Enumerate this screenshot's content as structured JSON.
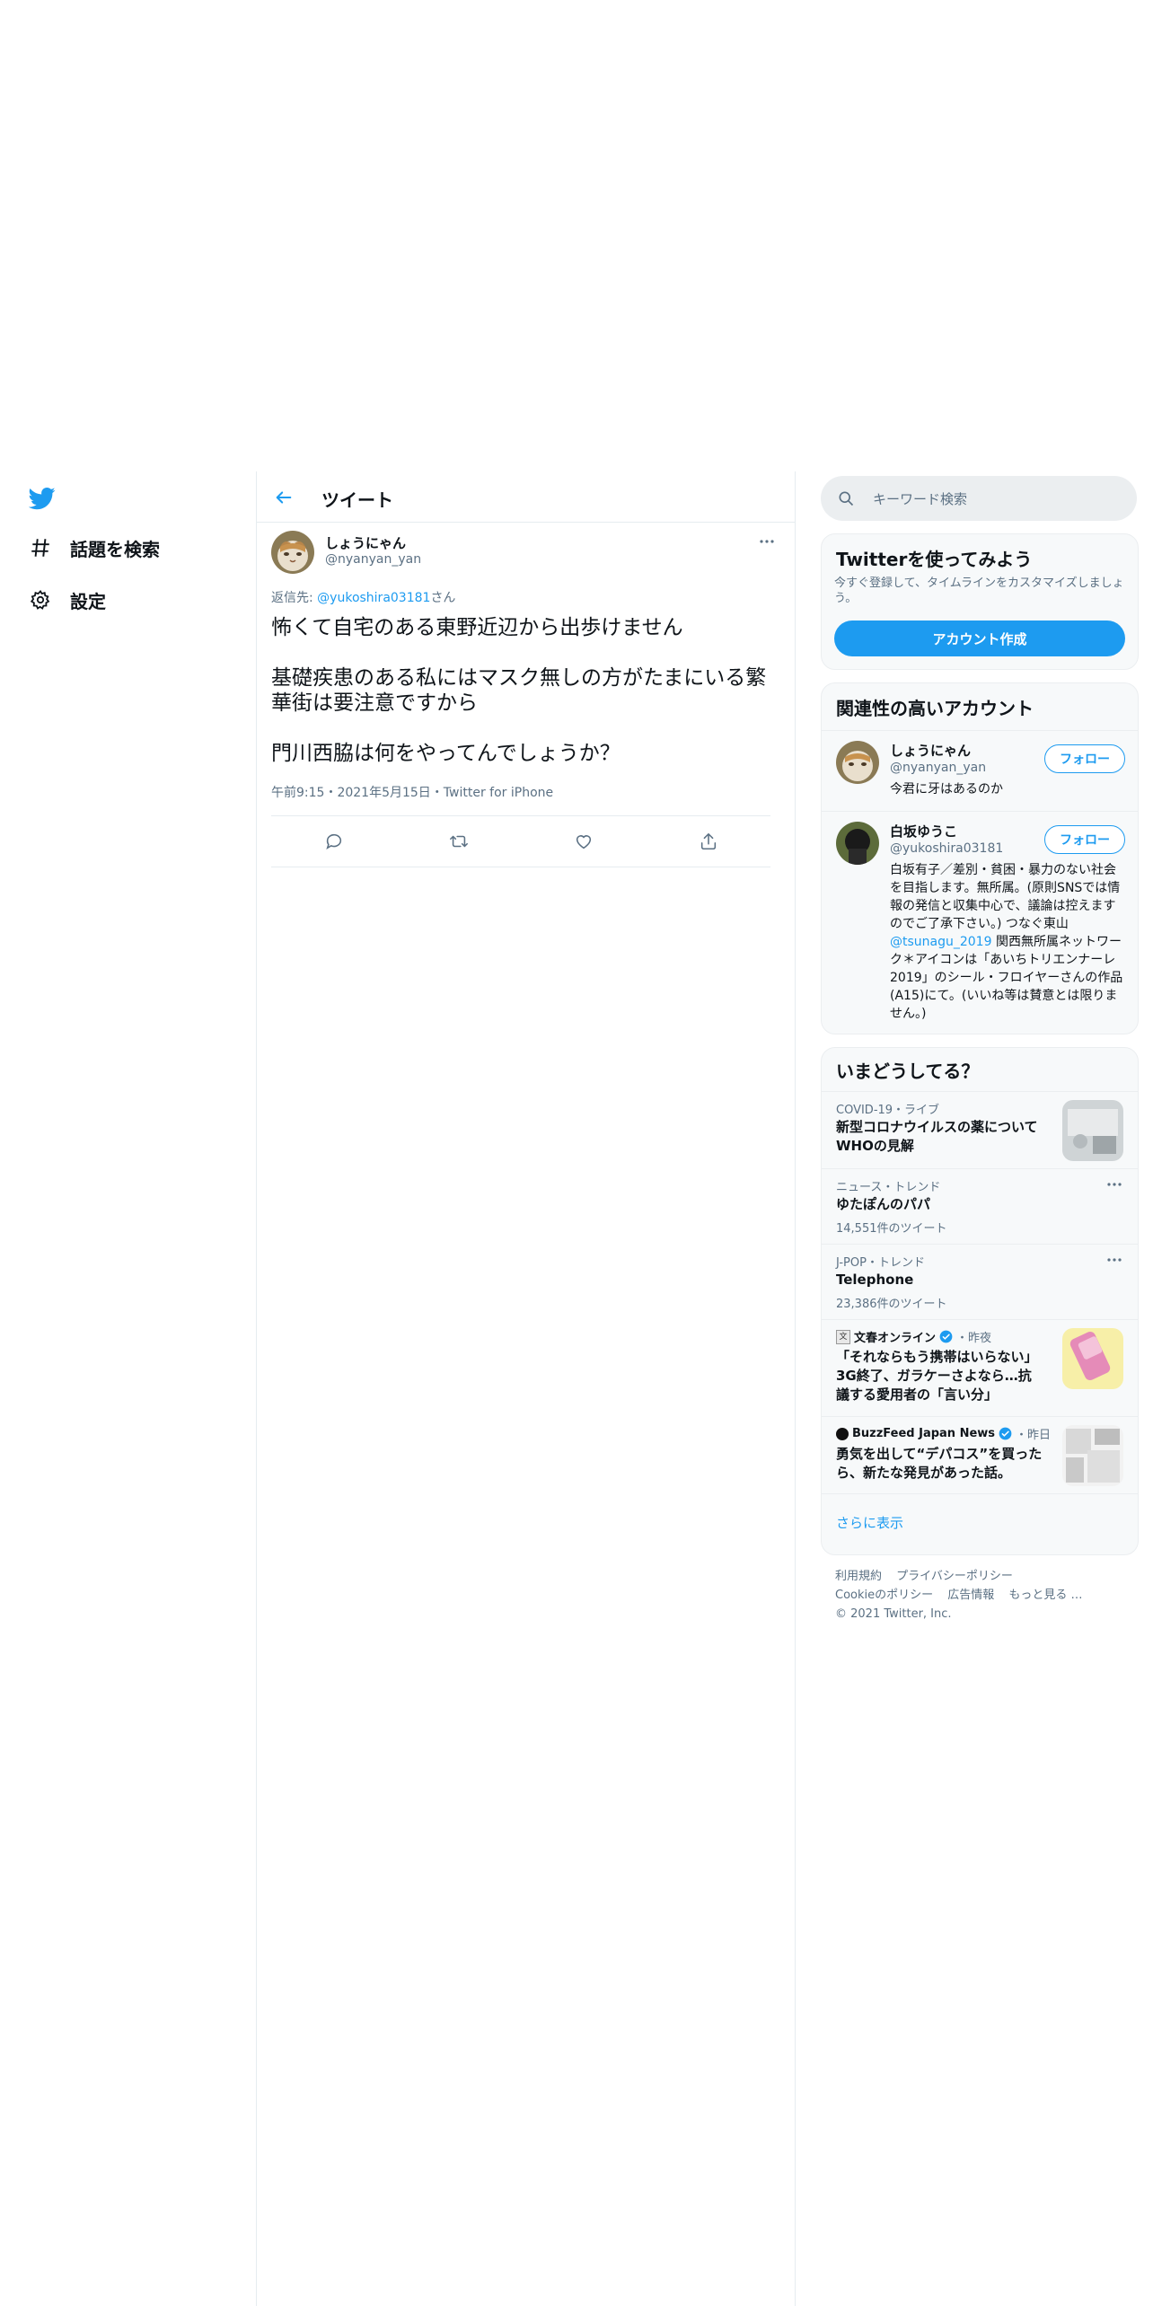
{
  "nav": {
    "explore_label": "話題を検索",
    "settings_label": "設定"
  },
  "header": {
    "title": "ツイート"
  },
  "tweet": {
    "display_name": "しょうにゃん",
    "handle": "@nyanyan_yan",
    "reply_prefix": "返信先: ",
    "reply_mention": "@yukoshira03181",
    "reply_suffix": "さん",
    "text": "怖くて自宅のある東野近辺から出歩けません\n\n基礎疾患のある私にはマスク無しの方がたまにいる繁華街は要注意ですから\n\n門川西脇は何をやってんでしょうか？",
    "meta": "午前9:15・2021年5月15日・Twitter for iPhone"
  },
  "search": {
    "placeholder": "キーワード検索"
  },
  "try_card": {
    "title": "Twitterを使ってみよう",
    "desc": "今すぐ登録して、タイムラインをカスタマイズしましょう。",
    "button": "アカウント作成"
  },
  "related": {
    "title": "関連性の高いアカウント",
    "accounts": [
      {
        "name": "しょうにゃん",
        "handle": "@nyanyan_yan",
        "follow": "フォロー",
        "bio": "今君に牙はあるのか"
      },
      {
        "name": "白坂ゆうこ",
        "handle": "@yukoshira03181",
        "follow": "フォロー",
        "bio_a": "白坂有子／差別・貧困・暴力のない社会を目指します。無所属。(原則SNSでは情報の発信と収集中心で、議論は控えますのでご了承下さい。) つなぐ東山",
        "bio_link": "@tsunagu_2019",
        "bio_b": " 関西無所属ネットワーク＊アイコンは「あいちトリエンナーレ2019」のシール・フロイヤーさんの作品(A15)にて。(いいね等は賛意とは限りません。)"
      }
    ]
  },
  "trends": {
    "title": "いまどうしてる？",
    "items": [
      {
        "meta": "COVID-19・ライブ",
        "title": "新型コロナウイルスの薬について WHOの見解"
      },
      {
        "meta": "ニュース・トレンド",
        "title": "ゆたぽんのパパ",
        "count": "14,551件のツイート"
      },
      {
        "meta": "J-POP・トレンド",
        "title": "Telephone",
        "count": "23,386件のツイート"
      },
      {
        "source": "文春オンライン",
        "time": "・昨夜",
        "title": "「それならもう携帯はいらない」3G終了、ガラケーさよなら…抗議する愛用者の「言い分」"
      },
      {
        "source": "BuzzFeed Japan News",
        "time": "・昨日",
        "title": "勇気を出して“デパコス”を買ったら、新たな発見があった話。"
      }
    ],
    "show_more": "さらに表示"
  },
  "footer": {
    "links": [
      "利用規約",
      "プライバシーポリシー",
      "Cookieのポリシー",
      "広告情報",
      "もっと見る …"
    ],
    "copyright": "© 2021 Twitter, Inc."
  },
  "colors": {
    "accent": "#1d9bf0",
    "text": "#0f1419",
    "secondary": "#5b7083",
    "border": "#e6ecf0"
  },
  "icons": [
    "twitter-logo-icon",
    "hashtag-icon",
    "gear-icon",
    "back-arrow-icon",
    "more-icon",
    "reply-icon",
    "retweet-icon",
    "like-icon",
    "share-icon",
    "search-icon",
    "verified-icon"
  ]
}
